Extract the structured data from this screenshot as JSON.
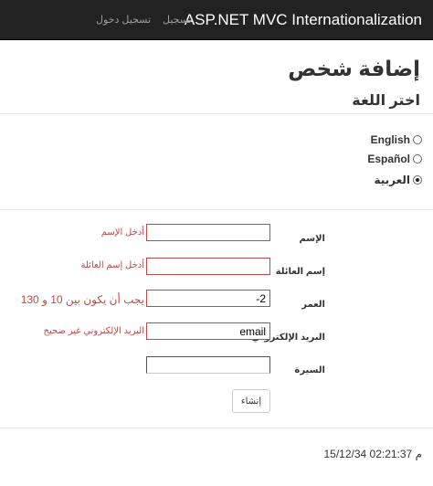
{
  "navbar": {
    "brand": "ASP.NET MVC Internationalization",
    "register": "تسجيل",
    "login": "تسجيل دخول"
  },
  "page": {
    "title": "إضافة شخص",
    "language_heading": "اختر اللغة"
  },
  "languages": {
    "english": "English",
    "spanish": "Español",
    "arabic": "العربية",
    "selected": "العربية"
  },
  "form": {
    "name": {
      "label": "الإسم",
      "value": "",
      "error": "أدخل الإسم"
    },
    "family_name": {
      "label": "إسم العائلة",
      "value": "",
      "error": "أدخل إسم العائلة"
    },
    "age": {
      "label": "العمر",
      "value": "-2",
      "error": "يجب أن يكون بين 10 و 130"
    },
    "email": {
      "label": "البريد الإلكتروني",
      "value": "email",
      "error": "البريد الإلكتروني غير صحيح"
    },
    "biography": {
      "label": "السيرة",
      "value": ""
    },
    "create_button": "إنشاء"
  },
  "footer": {
    "timestamp": "15/12/34 02:21:37 م"
  }
}
